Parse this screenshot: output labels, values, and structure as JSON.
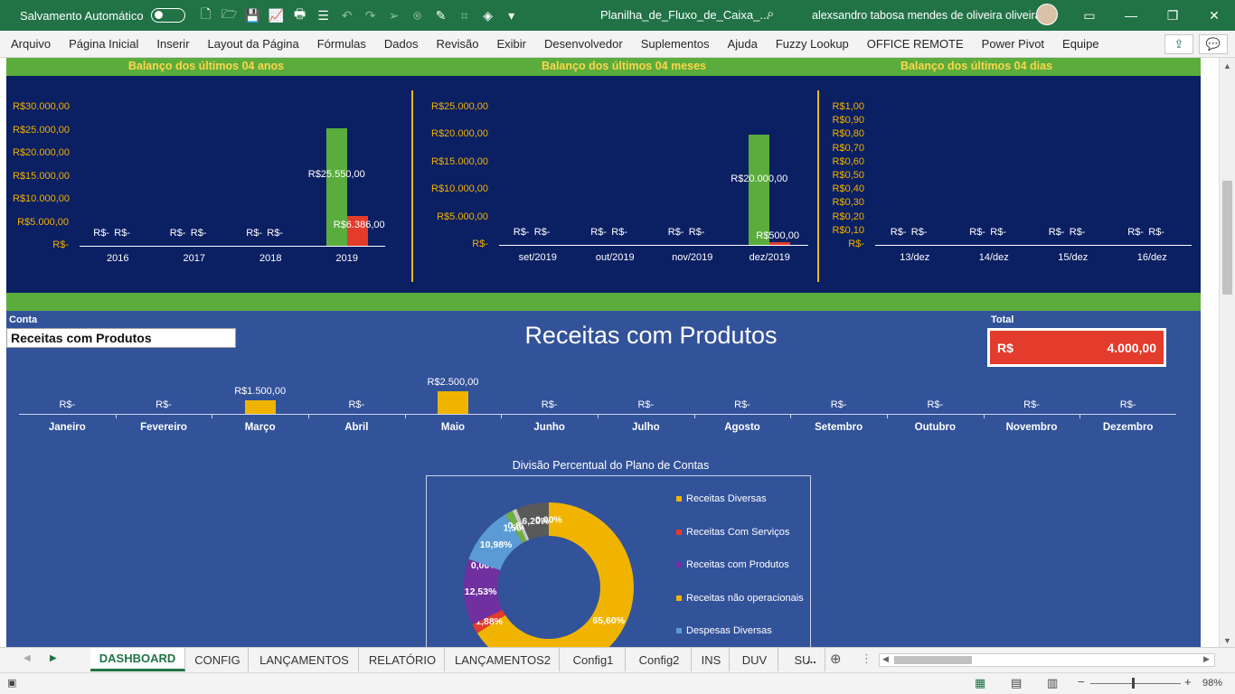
{
  "titlebar": {
    "autosave_label": "Salvamento Automático",
    "filename": "Planilha_de_Fluxo_de_Caixa_...",
    "user": "alexsandro tabosa mendes de oliveira oliveira"
  },
  "ribbon": {
    "tabs": [
      "Arquivo",
      "Página Inicial",
      "Inserir",
      "Layout da Página",
      "Fórmulas",
      "Dados",
      "Revisão",
      "Exibir",
      "Desenvolvedor",
      "Suplementos",
      "Ajuda",
      "Fuzzy Lookup",
      "OFFICE REMOTE",
      "Power Pivot",
      "Equipe"
    ]
  },
  "dashboard": {
    "headers": {
      "years": "Balanço dos últimos 04 anos",
      "months": "Balanço dos últimos 04 meses",
      "days": "Balanço dos últimos 04 dias"
    },
    "conta_label": "Conta",
    "conta_value": "Receitas com Produtos",
    "main_title": "Receitas com Produtos",
    "total_label": "Total",
    "total_currency": "R$",
    "total_value": "4.000,00",
    "donut_title": "Divisão Percentual do Plano de Contas"
  },
  "chart_data": [
    {
      "type": "bar",
      "title": "Balanço dos últimos 04 anos",
      "categories": [
        "2016",
        "2017",
        "2018",
        "2019"
      ],
      "series": [
        {
          "values": [
            0,
            0,
            0,
            25550
          ],
          "color": "#5aad3c"
        },
        {
          "values": [
            0,
            0,
            0,
            6386
          ],
          "color": "#e33b2c"
        }
      ],
      "data_labels": [
        [
          "R$-",
          "R$-",
          "R$-",
          "R$25.550,00"
        ],
        [
          "R$-",
          "R$-",
          "R$-",
          "R$6.386,00"
        ]
      ],
      "ytick_labels": [
        "R$30.000,00",
        "R$25.000,00",
        "R$20.000,00",
        "R$15.000,00",
        "R$10.000,00",
        "R$5.000,00",
        "R$-"
      ],
      "ylim": [
        0,
        30000
      ]
    },
    {
      "type": "bar",
      "title": "Balanço dos últimos 04 meses",
      "categories": [
        "set/2019",
        "out/2019",
        "nov/2019",
        "dez/2019"
      ],
      "series": [
        {
          "values": [
            0,
            0,
            0,
            20000
          ],
          "color": "#5aad3c"
        },
        {
          "values": [
            0,
            0,
            0,
            500
          ],
          "color": "#e33b2c"
        }
      ],
      "data_labels": [
        [
          "R$-",
          "R$-",
          "R$-",
          "R$20.000,00"
        ],
        [
          "R$-",
          "R$-",
          "R$-",
          "R$500,00"
        ]
      ],
      "ytick_labels": [
        "R$25.000,00",
        "R$20.000,00",
        "R$15.000,00",
        "R$10.000,00",
        "R$5.000,00",
        "R$-"
      ],
      "ylim": [
        0,
        25000
      ]
    },
    {
      "type": "bar",
      "title": "Balanço dos últimos 04 dias",
      "categories": [
        "13/dez",
        "14/dez",
        "15/dez",
        "16/dez"
      ],
      "series": [
        {
          "values": [
            0,
            0,
            0,
            0
          ],
          "color": "#5aad3c"
        },
        {
          "values": [
            0,
            0,
            0,
            0
          ],
          "color": "#e33b2c"
        }
      ],
      "data_labels": [
        [
          "R$-",
          "R$-",
          "R$-",
          "R$-"
        ],
        [
          "R$-",
          "R$-",
          "R$-",
          "R$-"
        ]
      ],
      "ytick_labels": [
        "R$1,00",
        "R$0,90",
        "R$0,80",
        "R$0,70",
        "R$0,60",
        "R$0,50",
        "R$0,40",
        "R$0,30",
        "R$0,20",
        "R$0,10",
        "R$-"
      ],
      "ylim": [
        0,
        1
      ]
    },
    {
      "type": "bar",
      "title": "Receitas com Produtos",
      "categories": [
        "Janeiro",
        "Fevereiro",
        "Março",
        "Abril",
        "Maio",
        "Junho",
        "Julho",
        "Agosto",
        "Setembro",
        "Outubro",
        "Novembro",
        "Dezembro"
      ],
      "values": [
        0,
        0,
        1500,
        0,
        2500,
        0,
        0,
        0,
        0,
        0,
        0,
        0
      ],
      "data_labels": [
        "R$-",
        "R$-",
        "R$1.500,00",
        "R$-",
        "R$2.500,00",
        "R$-",
        "R$-",
        "R$-",
        "R$-",
        "R$-",
        "R$-",
        "R$-"
      ],
      "color": "#f0b400",
      "ylim": [
        0,
        2500
      ]
    },
    {
      "type": "pie",
      "title": "Divisão Percentual do Plano de Contas",
      "legend": [
        "Receitas Diversas",
        "Receitas Com Serviços",
        "Receitas com Produtos",
        "Receitas não operacionais",
        "Despesas Diversas"
      ],
      "legend_colors": [
        "#f0b400",
        "#e33b2c",
        "#7030a0",
        "#f0b400",
        "#5b9bd5"
      ],
      "slices": [
        {
          "value": 65.6,
          "label": "65,60%",
          "color": "#f0b400"
        },
        {
          "value": 1.88,
          "label": "1,88%",
          "color": "#e33b2c"
        },
        {
          "value": 12.53,
          "label": "12,53%",
          "color": "#7030a0"
        },
        {
          "value": 0.0,
          "label": "0,00%",
          "color": "#f0b400"
        },
        {
          "value": 10.98,
          "label": "10,98%",
          "color": "#5b9bd5"
        },
        {
          "value": 1.5,
          "label": "1,50%",
          "color": "#70ad47"
        },
        {
          "value": 0.82,
          "label": "0,82%",
          "color": "#c9c9c9"
        },
        {
          "value": 6.2,
          "label": "6,20%",
          "color": "#595959"
        },
        {
          "value": 0.0,
          "label": "0,00%",
          "color": "#a5a5a5"
        }
      ]
    }
  ],
  "sheet_tabs": [
    "DASHBOARD",
    "CONFIG",
    "LANÇAMENTOS",
    "RELATÓRIO",
    "LANÇAMENTOS2",
    "Config1",
    "Config2",
    "INS",
    "DUV",
    "SU"
  ],
  "status": {
    "zoom": "98%"
  }
}
